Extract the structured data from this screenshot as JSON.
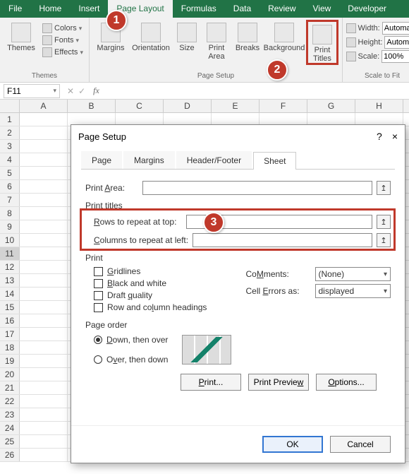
{
  "ribbon_tabs": {
    "file": "File",
    "home": "Home",
    "insert": "Insert",
    "page_layout": "Page Layout",
    "formulas": "Formulas",
    "data": "Data",
    "review": "Review",
    "view": "View",
    "developer": "Developer"
  },
  "ribbon": {
    "themes_group": "Themes",
    "themes_btn": "Themes",
    "colors": "Colors",
    "fonts": "Fonts",
    "effects": "Effects",
    "page_setup_group": "Page Setup",
    "margins": "Margins",
    "orientation": "Orientation",
    "size": "Size",
    "print_area": "Print Area",
    "breaks": "Breaks",
    "background": "Background",
    "print_titles": "Print Titles",
    "scale_group": "Scale to Fit",
    "width_lbl": "Width:",
    "height_lbl": "Height:",
    "scale_lbl": "Scale:",
    "width_val": "Automa",
    "height_val": "Automa",
    "scale_val": "100%"
  },
  "formula_bar": {
    "name_box": "F11",
    "fx": "fx",
    "formula": ""
  },
  "columns": [
    "A",
    "B",
    "C",
    "D",
    "E",
    "F",
    "G",
    "H"
  ],
  "row_count": 26,
  "selected_cell": {
    "row": 11,
    "col": "F"
  },
  "dialog": {
    "title": "Page Setup",
    "help": "?",
    "close": "×",
    "tabs": {
      "page": "Page",
      "margins": "Margins",
      "header_footer": "Header/Footer",
      "sheet": "Sheet"
    },
    "print_area_lbl": "Print area:",
    "print_area_hotkey": "A",
    "print_titles_lbl": "Print titles",
    "rows_repeat_lbl_pre": "R",
    "rows_repeat_lbl_rest": "ows to repeat at top:",
    "cols_repeat_lbl_pre": "C",
    "cols_repeat_lbl_rest": "olumns to repeat at left:",
    "rows_repeat_val": "",
    "cols_repeat_val": "",
    "print_lbl": "Print",
    "gridlines_pre": "G",
    "gridlines_rest": "ridlines",
    "bw_pre": "B",
    "bw_rest": "lack and white",
    "draft_pre": "Q",
    "draft_lbl": "Draft quality",
    "rowcol_pre": "L",
    "rowcol_lbl": "Row and column headings",
    "comments_lbl": "Comments:",
    "comments_hot": "M",
    "comments_val": "(None)",
    "errors_lbl": "Cell errors as:",
    "errors_hot": "E",
    "errors_val": "displayed",
    "page_order_lbl": "Page order",
    "down_over_pre": "D",
    "down_over_rest": "own, then over",
    "over_down_pre": "v",
    "over_down_lbl": "Over, then down",
    "over_down_prefix": "O",
    "print_btn": "Print...",
    "preview_btn": "Print Preview",
    "options_btn": "Options...",
    "ok_btn": "OK",
    "cancel_btn": "Cancel"
  },
  "annotations": {
    "one": "1",
    "two": "2",
    "three": "3"
  }
}
